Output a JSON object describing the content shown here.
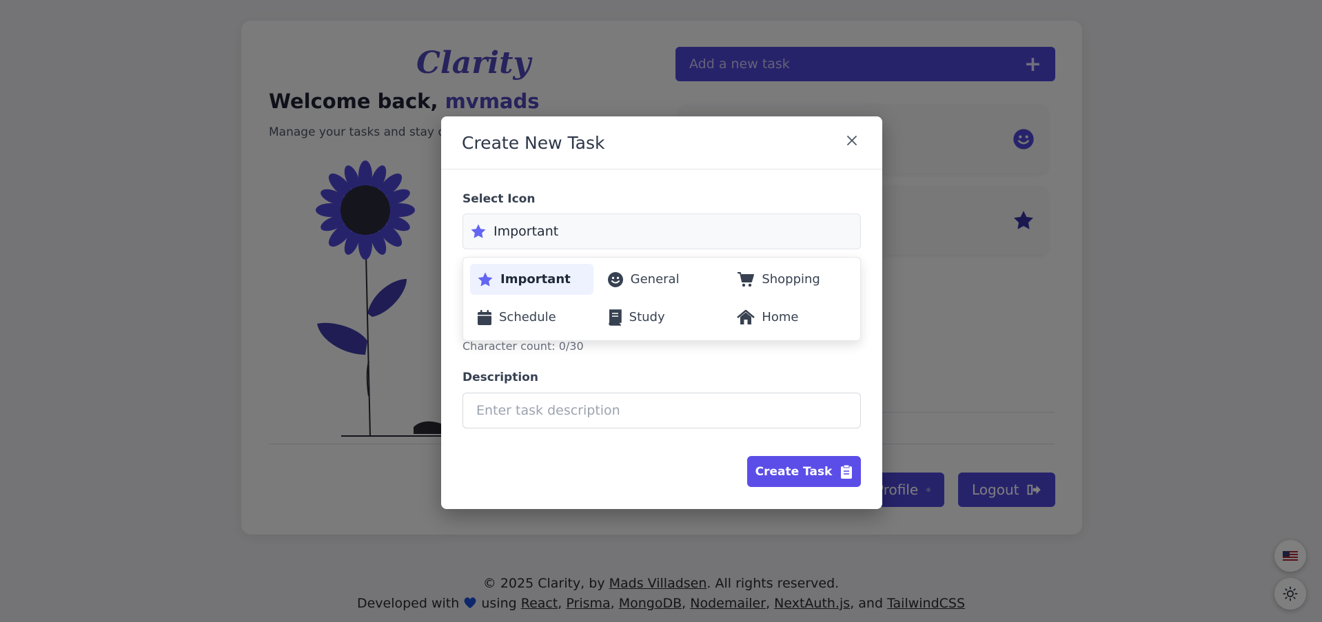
{
  "app": {
    "logo": "Clarity",
    "welcome_prefix": "Welcome back, ",
    "username": "mvmads",
    "subtitle": "Manage your tasks and stay orga"
  },
  "header_actions": {
    "add_task_label": "Add a new task"
  },
  "buttons": {
    "profile_label": "Profile",
    "logout_label": "Logout"
  },
  "footer": {
    "line1_prefix": "© 2025 Clarity, by ",
    "author": "Mads Villadsen",
    "line1_suffix": ". All rights reserved.",
    "line2_prefix": "Developed with ",
    "line2_using": " using ",
    "links": [
      "React",
      "Prisma",
      "MongoDB",
      "Nodemailer",
      "NextAuth.js",
      "TailwindCSS"
    ],
    "separator": ", ",
    "and": ", and "
  },
  "modal": {
    "title": "Create New Task",
    "select_icon_label": "Select Icon",
    "selected_icon": "Important",
    "char_count": "Character count: 0/30",
    "description_label": "Description",
    "description_placeholder": "Enter task description",
    "create_label": "Create Task",
    "icon_options": [
      {
        "label": "Important",
        "icon": "star-icon"
      },
      {
        "label": "General",
        "icon": "smile-icon"
      },
      {
        "label": "Shopping",
        "icon": "cart-icon"
      },
      {
        "label": "Schedule",
        "icon": "calendar-icon"
      },
      {
        "label": "Study",
        "icon": "book-icon"
      },
      {
        "label": "Home",
        "icon": "home-icon"
      }
    ]
  },
  "colors": {
    "brand": "#4f46d6",
    "accent": "#5b4ee8",
    "star": "#6366f1",
    "dark_icon": "#374151"
  }
}
